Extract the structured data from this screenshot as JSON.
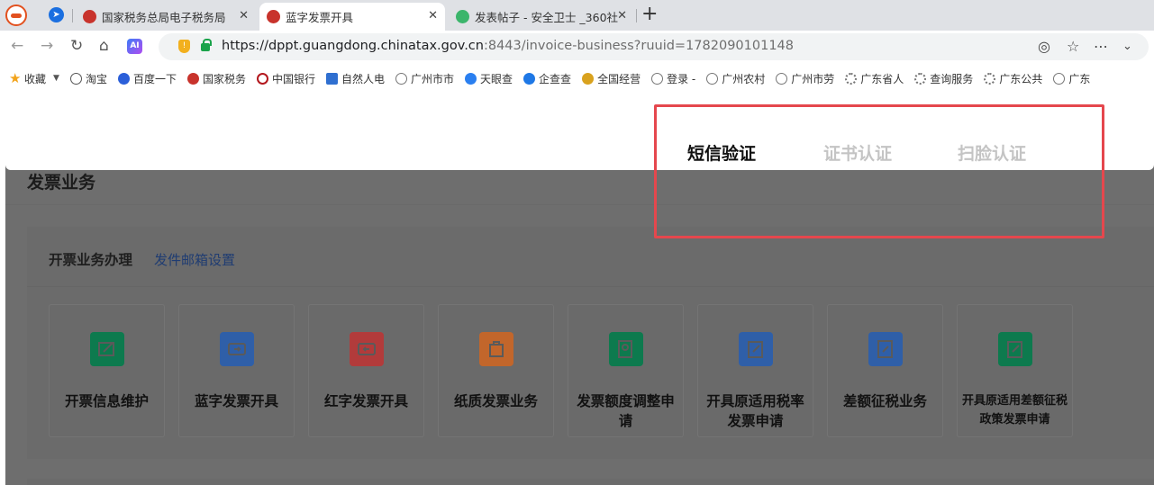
{
  "browser": {
    "tabs": [
      {
        "title": "国家税务总局电子税务局",
        "active": false
      },
      {
        "title": "蓝字发票开具",
        "active": true
      },
      {
        "title": "发表帖子 - 安全卫士 _360社",
        "active": false
      }
    ],
    "close_glyph": "✕",
    "new_tab_glyph": "+",
    "url_host": "https://dppt.guangdong.chinatax.gov.cn",
    "url_rest": ":8443/invoice-business?ruuid=1782090101148"
  },
  "bookmarks": [
    {
      "label": "收藏",
      "icon": "star-icon"
    },
    {
      "label": "淘宝",
      "icon": "taobao-icon"
    },
    {
      "label": "百度一下",
      "icon": "baidu-icon"
    },
    {
      "label": "国家税务",
      "icon": "tax-emblem-icon"
    },
    {
      "label": "中国银行",
      "icon": "boc-icon"
    },
    {
      "label": "自然人电",
      "icon": "tax-app-icon"
    },
    {
      "label": "广州市市",
      "icon": "globe-icon"
    },
    {
      "label": "天眼查",
      "icon": "tianyancha-icon"
    },
    {
      "label": "企查查",
      "icon": "qichacha-icon"
    },
    {
      "label": "全国经营",
      "icon": "national-emblem-icon"
    },
    {
      "label": "登录 -",
      "icon": "globe-icon"
    },
    {
      "label": "广州农村",
      "icon": "globe-icon"
    },
    {
      "label": "广州市劳",
      "icon": "globe-icon"
    },
    {
      "label": "广东省人",
      "icon": "gear-globe-icon"
    },
    {
      "label": "查询服务",
      "icon": "gear-globe-icon"
    },
    {
      "label": "广东公共",
      "icon": "gear-globe-icon"
    },
    {
      "label": "广东",
      "icon": "globe-icon"
    }
  ],
  "modal": {
    "tabs": [
      {
        "label": "短信验证",
        "active": true
      },
      {
        "label": "证书认证",
        "active": false
      },
      {
        "label": "扫脸认证",
        "active": false
      }
    ]
  },
  "page": {
    "title": "发票业务",
    "section_title": "开票业务办理",
    "section_link": "发件邮箱设置",
    "tiles": [
      {
        "label": "开票信息维护",
        "icon": "edit-invoice-icon",
        "color": "#0d7a4e"
      },
      {
        "label": "蓝字发票开具",
        "icon": "blue-ticket-icon",
        "color": "#2f5fa8"
      },
      {
        "label": "红字发票开具",
        "icon": "red-ticket-icon",
        "color": "#b23b3b"
      },
      {
        "label": "纸质发票业务",
        "icon": "paper-invoice-icon",
        "color": "#c2662b"
      },
      {
        "label": "发票额度调整申请",
        "icon": "quota-adjust-icon",
        "color": "#0d7a4e"
      },
      {
        "label": "开具原适用税率发票申请",
        "icon": "tax-rate-icon",
        "color": "#2f5fa8"
      },
      {
        "label": "差额征税业务",
        "icon": "differential-tax-icon",
        "color": "#2f5fa8"
      },
      {
        "label": "开具原适用差额征税政策发票申请",
        "icon": "diff-policy-icon",
        "color": "#0d7a4e"
      }
    ]
  },
  "colors": {
    "highlight": "#e5474d",
    "link": "#1f3c72",
    "overlay": "#6e6e6e"
  }
}
